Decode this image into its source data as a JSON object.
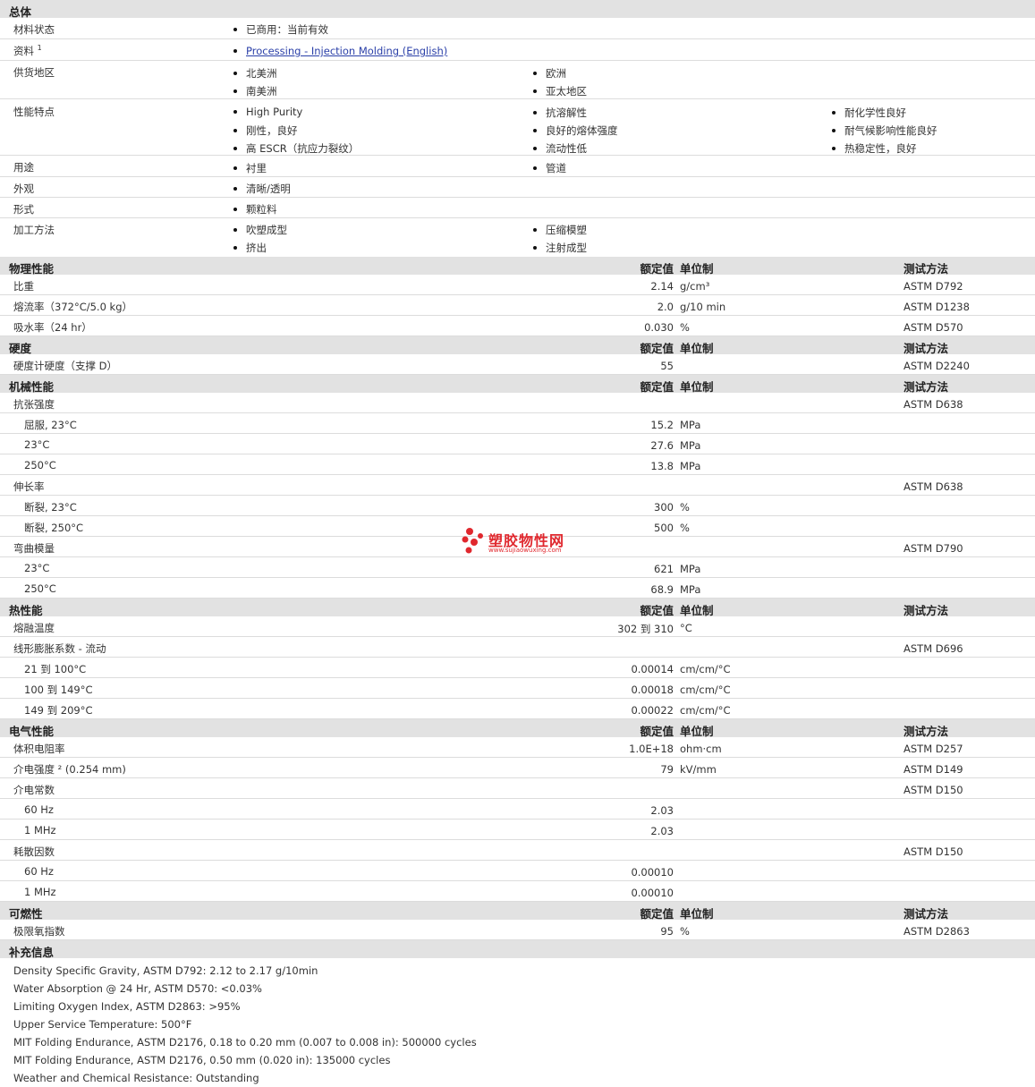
{
  "general": {
    "title": "总体",
    "status_label": "材料状态",
    "status_value": "已商用：当前有效",
    "docs_label": "资料",
    "docs_sup": "1",
    "docs_link": "Processing - Injection Molding (English)",
    "region_label": "供货地区",
    "regions": [
      "北美洲",
      "欧洲",
      "南美洲",
      "亚太地区"
    ],
    "features_label": "性能特点",
    "features": [
      "High Purity",
      "抗溶解性",
      "耐化学性良好",
      "刚性，良好",
      "良好的熔体强度",
      "耐气候影响性能良好",
      "高 ESCR（抗应力裂纹）",
      "流动性低",
      "热稳定性，良好"
    ],
    "uses_label": "用途",
    "uses": [
      "衬里",
      "管道"
    ],
    "appearance_label": "外观",
    "appearance": "清晰/透明",
    "form_label": "形式",
    "form": "颗粒料",
    "process_label": "加工方法",
    "process": [
      "吹塑成型",
      "压缩模塑",
      "挤出",
      "注射成型"
    ]
  },
  "headers": {
    "value": "额定值",
    "unit": "单位制",
    "test": "测试方法"
  },
  "physical": {
    "title": "物理性能",
    "rows": [
      {
        "label": "比重",
        "value": "2.14",
        "unit": "g/cm³",
        "test": "ASTM D792"
      },
      {
        "label": "熔流率（372°C/5.0 kg）",
        "value": "2.0",
        "unit": "g/10 min",
        "test": "ASTM D1238"
      },
      {
        "label": "吸水率（24 hr）",
        "value": "0.030",
        "unit": "%",
        "test": "ASTM D570"
      }
    ]
  },
  "hardness": {
    "title": "硬度",
    "rows": [
      {
        "label": "硬度计硬度（支撑 D）",
        "value": "55",
        "unit": "",
        "test": "ASTM D2240"
      }
    ]
  },
  "mechanical": {
    "title": "机械性能",
    "rows": [
      {
        "label": "抗张强度",
        "value": "",
        "unit": "",
        "test": "ASTM D638",
        "sub": false
      },
      {
        "label": "屈服, 23°C",
        "value": "15.2",
        "unit": "MPa",
        "test": "",
        "sub": true
      },
      {
        "label": "23°C",
        "value": "27.6",
        "unit": "MPa",
        "test": "",
        "sub": true
      },
      {
        "label": "250°C",
        "value": "13.8",
        "unit": "MPa",
        "test": "",
        "sub": true
      },
      {
        "label": "伸长率",
        "value": "",
        "unit": "",
        "test": "ASTM D638",
        "sub": false
      },
      {
        "label": "断裂, 23°C",
        "value": "300",
        "unit": "%",
        "test": "",
        "sub": true
      },
      {
        "label": "断裂, 250°C",
        "value": "500",
        "unit": "%",
        "test": "",
        "sub": true
      },
      {
        "label": "弯曲模量",
        "value": "",
        "unit": "",
        "test": "ASTM D790",
        "sub": false
      },
      {
        "label": "23°C",
        "value": "621",
        "unit": "MPa",
        "test": "",
        "sub": true
      },
      {
        "label": "250°C",
        "value": "68.9",
        "unit": "MPa",
        "test": "",
        "sub": true
      }
    ]
  },
  "thermal": {
    "title": "热性能",
    "rows": [
      {
        "label": "熔融温度",
        "value": "302 到  310",
        "unit": "°C",
        "test": "",
        "sub": false
      },
      {
        "label": "线形膨胀系数 - 流动",
        "value": "",
        "unit": "",
        "test": "ASTM D696",
        "sub": false
      },
      {
        "label": "21 到  100°C",
        "value": "0.00014",
        "unit": "cm/cm/°C",
        "test": "",
        "sub": true
      },
      {
        "label": "100 到  149°C",
        "value": "0.00018",
        "unit": "cm/cm/°C",
        "test": "",
        "sub": true
      },
      {
        "label": "149 到  209°C",
        "value": "0.00022",
        "unit": "cm/cm/°C",
        "test": "",
        "sub": true
      }
    ]
  },
  "electrical": {
    "title": "电气性能",
    "rows": [
      {
        "label": "体积电阻率",
        "value": "1.0E+18",
        "unit": "ohm·cm",
        "test": "ASTM D257",
        "sub": false
      },
      {
        "label": "介电强度 ² (0.254 mm)",
        "value": "79",
        "unit": "kV/mm",
        "test": "ASTM D149",
        "sub": false
      },
      {
        "label": "介电常数",
        "value": "",
        "unit": "",
        "test": "ASTM D150",
        "sub": false
      },
      {
        "label": "60 Hz",
        "value": "2.03",
        "unit": "",
        "test": "",
        "sub": true
      },
      {
        "label": "1 MHz",
        "value": "2.03",
        "unit": "",
        "test": "",
        "sub": true
      },
      {
        "label": "耗散因数",
        "value": "",
        "unit": "",
        "test": "ASTM D150",
        "sub": false
      },
      {
        "label": "60 Hz",
        "value": "0.00010",
        "unit": "",
        "test": "",
        "sub": true
      },
      {
        "label": "1 MHz",
        "value": "0.00010",
        "unit": "",
        "test": "",
        "sub": true
      }
    ]
  },
  "flammability": {
    "title": "可燃性",
    "rows": [
      {
        "label": "极限氧指数",
        "value": "95",
        "unit": "%",
        "test": "ASTM D2863",
        "sub": false
      }
    ]
  },
  "supplement": {
    "title": "补充信息",
    "notes": [
      "Density Specific Gravity, ASTM D792: 2.12 to 2.17 g/10min",
      "Water Absorption @ 24 Hr, ASTM D570: <0.03%",
      "Limiting Oxygen Index, ASTM D2863: >95%",
      "Upper Service Temperature: 500°F",
      "MIT Folding Endurance, ASTM D2176, 0.18 to 0.20 mm (0.007 to 0.008 in): 500000 cycles",
      "MIT Folding Endurance, ASTM D2176, 0.50 mm (0.020 in): 135000 cycles",
      "Weather and Chemical Resistance: Outstanding"
    ]
  },
  "watermark": {
    "text": "塑胶物性网",
    "url": "www.sujiaowuxing.com"
  }
}
